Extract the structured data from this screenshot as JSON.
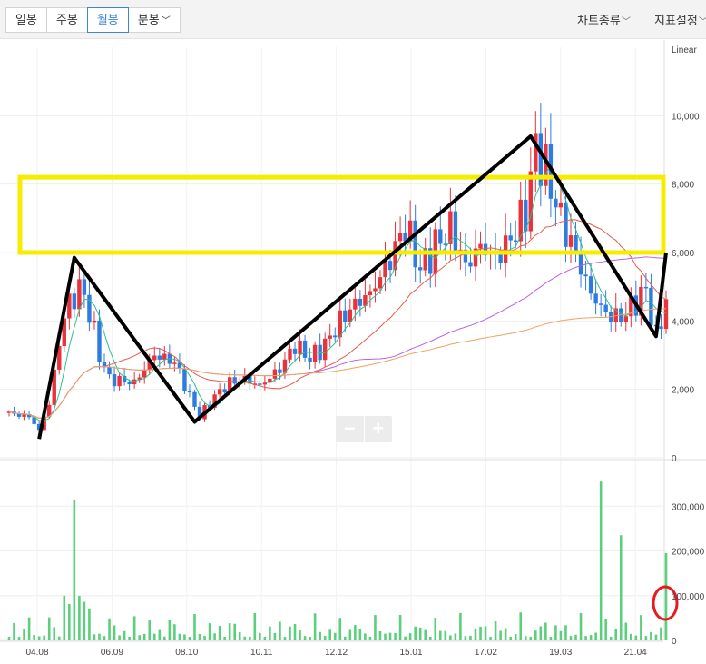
{
  "toolbar": {
    "tabs": [
      "일봉",
      "주봉",
      "월봉",
      "분봉"
    ],
    "active_tab": "월봉",
    "chart_type_label": "차트종류",
    "indicator_label": "지표설정"
  },
  "colors": {
    "up": "#e8323c",
    "down": "#2f7be0",
    "volume": "#5bcf7b",
    "ma5": "#2fbf8f",
    "ma20": "#e65a4e",
    "ma60": "#b864e0",
    "ma120": "#f0a35e",
    "zigzag": "#000000",
    "box": "#f5ec00",
    "circle": "#e8191f"
  },
  "chart_data": {
    "type": "candlestick",
    "scale_label": "Linear",
    "price_axis": {
      "min": 0,
      "max": 12000,
      "ticks": [
        "0",
        "2,000",
        "4,000",
        "6,000",
        "8,000",
        "10,000"
      ]
    },
    "volume_axis": {
      "min": 0,
      "max": 400000,
      "ticks": [
        "0",
        "100,000",
        "200,000",
        "300,000"
      ]
    },
    "x_ticks": [
      "04.08",
      "06.09",
      "08.10",
      "10.11",
      "12.12",
      "15.01",
      "17.02",
      "19.03",
      "21.04"
    ],
    "price_anchors": [
      [
        0,
        1300
      ],
      [
        4,
        1200
      ],
      [
        6,
        800
      ],
      [
        8,
        1600
      ],
      [
        11,
        4200
      ],
      [
        14,
        5000
      ],
      [
        16,
        4300
      ],
      [
        18,
        3000
      ],
      [
        20,
        2300
      ],
      [
        25,
        2200
      ],
      [
        29,
        3000
      ],
      [
        33,
        2800
      ],
      [
        36,
        1800
      ],
      [
        38,
        1200
      ],
      [
        41,
        1800
      ],
      [
        44,
        2200
      ],
      [
        47,
        2300
      ],
      [
        50,
        2100
      ],
      [
        54,
        2600
      ],
      [
        57,
        3300
      ],
      [
        60,
        2900
      ],
      [
        63,
        3300
      ],
      [
        66,
        4000
      ],
      [
        69,
        4500
      ],
      [
        72,
        4800
      ],
      [
        76,
        5800
      ],
      [
        79,
        6800
      ],
      [
        82,
        5500
      ],
      [
        85,
        6200
      ],
      [
        88,
        6700
      ],
      [
        91,
        5600
      ],
      [
        94,
        6200
      ],
      [
        97,
        5800
      ],
      [
        100,
        6400
      ],
      [
        103,
        7200
      ],
      [
        105,
        9100
      ],
      [
        107,
        8400
      ],
      [
        110,
        7000
      ],
      [
        113,
        5900
      ],
      [
        116,
        4800
      ],
      [
        119,
        4200
      ],
      [
        122,
        4100
      ],
      [
        124,
        4400
      ],
      [
        127,
        4900
      ],
      [
        129,
        3500
      ],
      [
        131,
        4600
      ]
    ],
    "volume_spikes": [
      [
        13,
        315000
      ],
      [
        118,
        355000
      ],
      [
        122,
        235000
      ],
      [
        131,
        195000
      ]
    ],
    "annotations": {
      "zigzag_prices": [
        [
          6,
          550
        ],
        [
          13,
          5850
        ],
        [
          37,
          1050
        ],
        [
          104,
          9400
        ],
        [
          129,
          3550
        ],
        [
          131,
          6000
        ]
      ],
      "horizontal_box_range": [
        6000,
        8200
      ],
      "circled_volume_bar": 131
    }
  }
}
